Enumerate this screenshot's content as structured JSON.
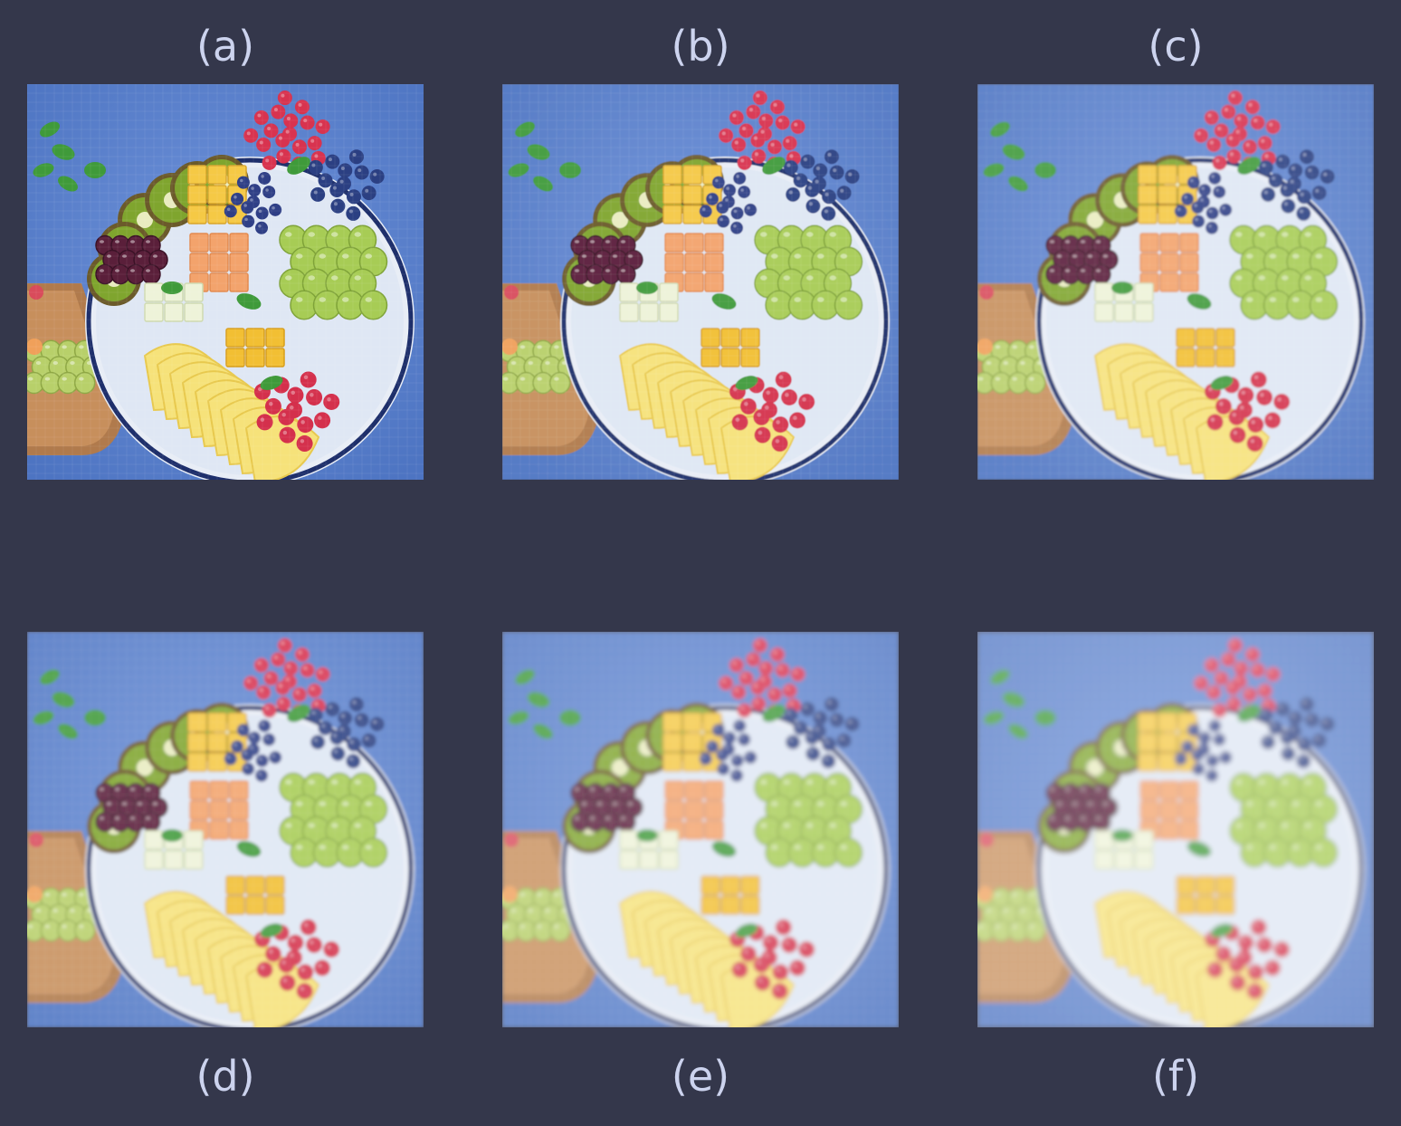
{
  "panels": [
    {
      "label": "(a)",
      "blur": 0,
      "wash": 0.0
    },
    {
      "label": "(b)",
      "blur": 0.6,
      "wash": 0.05
    },
    {
      "label": "(c)",
      "blur": 1.1,
      "wash": 0.1
    },
    {
      "label": "(d)",
      "blur": 1.6,
      "wash": 0.12
    },
    {
      "label": "(e)",
      "blur": 2.1,
      "wash": 0.18
    },
    {
      "label": "(f)",
      "blur": 2.6,
      "wash": 0.24
    }
  ],
  "colors": {
    "background": "#34374b",
    "label_text": "#ccd3ee",
    "table_blue": "#5b82cf"
  }
}
